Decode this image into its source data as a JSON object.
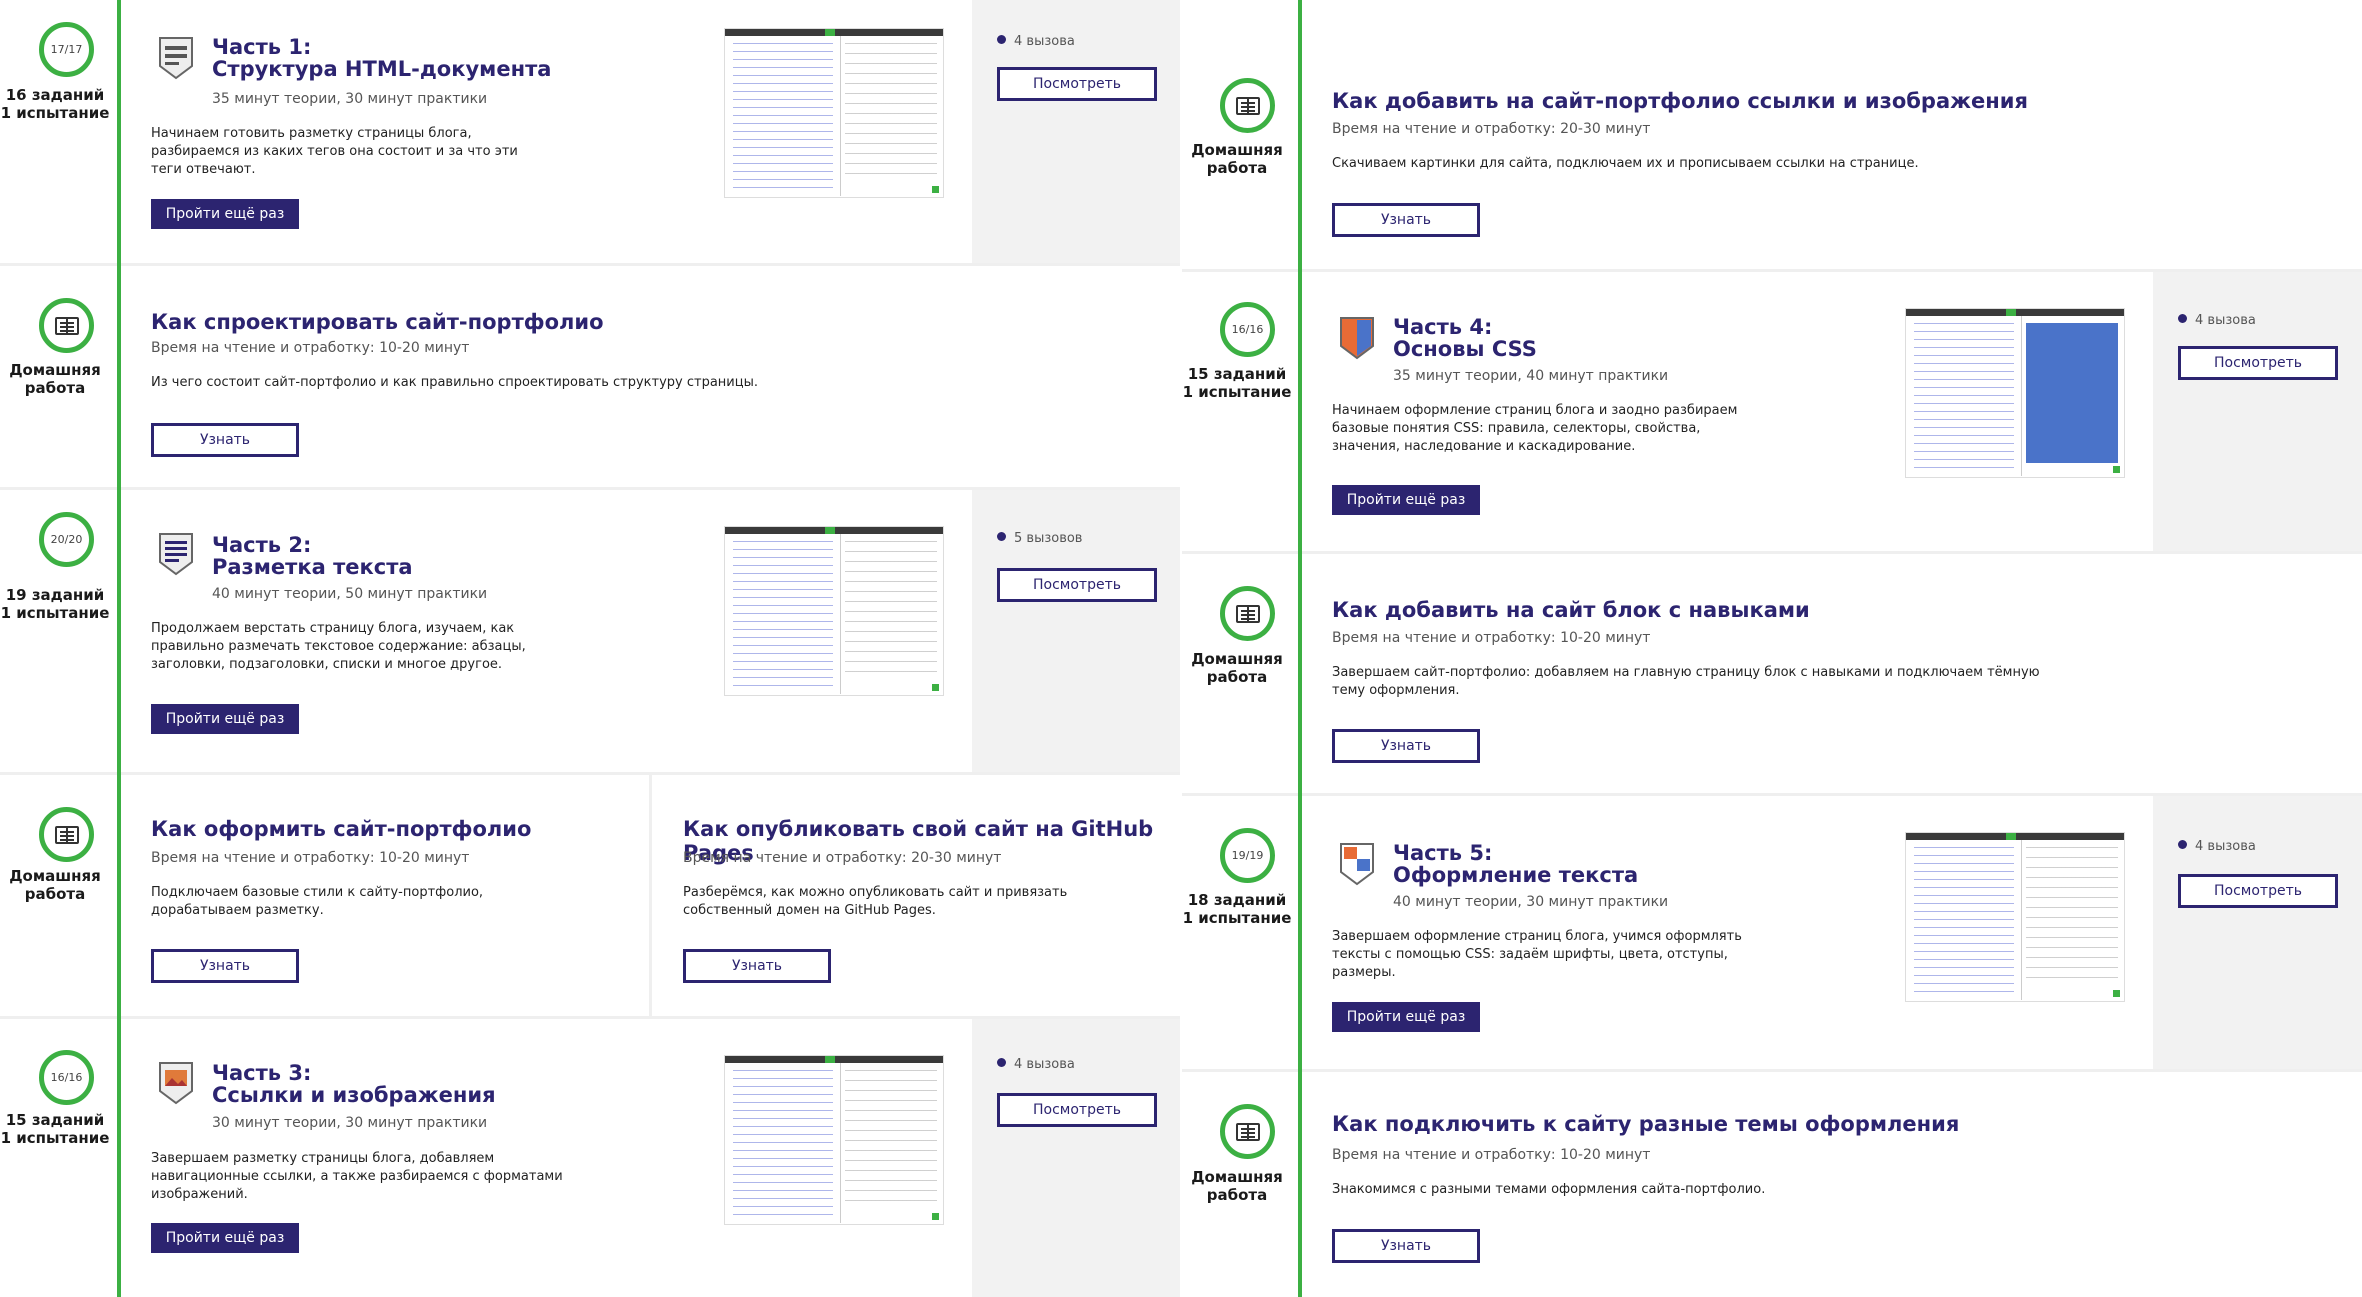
{
  "left": {
    "parts": [
      {
        "badge": "17/17",
        "tasks": "16 заданий",
        "trial": "1 испытание",
        "title1": "Часть 1:",
        "title2": "Структура HTML-документа",
        "meta": "35 минут теории, 30 минут практики",
        "desc": "Начинаем готовить разметку страницы блога, разбираемся из каких тегов она состоит и за что эти теги отвечают.",
        "button": "Пройти ещё раз",
        "calls": "4 вызова",
        "view": "Посмотреть"
      },
      {
        "badge": "20/20",
        "tasks": "19 заданий",
        "trial": "1 испытание",
        "title1": "Часть 2:",
        "title2": "Разметка текста",
        "meta": "40 минут теории, 50 минут практики",
        "desc": "Продолжаем верстать страницу блога, изучаем, как правильно размечать текстовое содержание: абзацы, заголовки, подзаголовки, списки и многое другое.",
        "button": "Пройти ещё раз",
        "calls": "5 вызовов",
        "view": "Посмотреть"
      },
      {
        "badge": "16/16",
        "tasks": "15 заданий",
        "trial": "1 испытание",
        "title1": "Часть 3:",
        "title2": "Ссылки и изображения",
        "meta": "30 минут теории, 30 минут практики",
        "desc": "Завершаем разметку страницы блога, добавляем навигационные ссылки, а также разбираемся с форматами изображений.",
        "button": "Пройти ещё раз",
        "calls": "4 вызова",
        "view": "Посмотреть"
      }
    ],
    "homeworks": [
      {
        "label1": "Домашняя",
        "label2": "работа",
        "title": "Как спроектировать сайт-портфолио",
        "meta": "Время на чтение и отработку: 10-20 минут",
        "desc": "Из чего состоит сайт-портфолио и как правильно спроектировать структуру страницы.",
        "button": "Узнать"
      },
      {
        "label1": "Домашняя",
        "label2": "работа",
        "title": "Как оформить сайт-портфолио",
        "meta": "Время на чтение и отработку: 10-20 минут",
        "desc": "Подключаем базовые стили к сайту-портфолио, дорабатываем разметку.",
        "button": "Узнать"
      },
      {
        "title": "Как опубликовать свой сайт на GitHub Pages",
        "meta": "Время на чтение и отработку: 20-30 минут",
        "desc": "Разберёмся, как можно опубликовать сайт и привязать собственный домен на GitHub Pages.",
        "button": "Узнать"
      }
    ]
  },
  "right": {
    "parts": [
      {
        "badge": "16/16",
        "tasks": "15 заданий",
        "trial": "1 испытание",
        "title1": "Часть 4:",
        "title2": "Основы CSS",
        "meta": "35 минут теории, 40 минут практики",
        "desc": "Начинаем оформление страниц блога и заодно разбираем базовые понятия CSS: правила, селекторы, свойства, значения, наследование и каскадирование.",
        "button": "Пройти ещё раз",
        "calls": "4 вызова",
        "view": "Посмотреть"
      },
      {
        "badge": "19/19",
        "tasks": "18 заданий",
        "trial": "1 испытание",
        "title1": "Часть 5:",
        "title2": "Оформление текста",
        "meta": "40 минут теории, 30 минут практики",
        "desc": "Завершаем оформление страниц блога, учимся оформлять тексты с помощью CSS: задаём шрифты, цвета, отступы, размеры.",
        "button": "Пройти ещё раз",
        "calls": "4 вызова",
        "view": "Посмотреть"
      }
    ],
    "homeworks": [
      {
        "label1": "Домашняя",
        "label2": "работа",
        "title": "Как добавить на сайт-портфолио ссылки и изображения",
        "meta": "Время на чтение и отработку: 20-30 минут",
        "desc": "Скачиваем картинки для сайта, подключаем их и прописываем ссылки на странице.",
        "button": "Узнать"
      },
      {
        "label1": "Домашняя",
        "label2": "работа",
        "title": "Как добавить на сайт блок с навыками",
        "meta": "Время на чтение и отработку: 10-20 минут",
        "desc": "Завершаем сайт-портфолио: добавляем на главную страницу блок с навыками и подключаем тёмную тему оформления.",
        "button": "Узнать"
      },
      {
        "label1": "Домашняя",
        "label2": "работа",
        "title": "Как подключить к сайту разные темы оформления",
        "meta": "Время на чтение и отработку: 10-20 минут",
        "desc": "Знакомимся с разными темами оформления сайта-портфолио.",
        "button": "Узнать"
      }
    ]
  }
}
